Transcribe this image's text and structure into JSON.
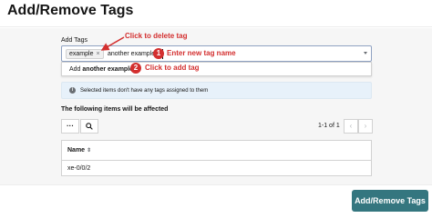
{
  "modal": {
    "title": "Add/Remove Tags",
    "submit_label": "Add/Remove Tags"
  },
  "tags_field": {
    "label": "Add Tags",
    "chips": [
      {
        "label": "example",
        "remove_glyph": "×"
      }
    ],
    "typed_text": "another example",
    "suggestion_prefix": "Add ",
    "suggestion_value": "another example"
  },
  "alert": {
    "icon": "info-icon",
    "icon_glyph": "i",
    "text": "Selected items don't have any tags assigned to them"
  },
  "affected": {
    "label": "The following items will be affected",
    "toolbar": {
      "more_glyph": "···",
      "search_icon": "search-icon"
    },
    "pagination": {
      "text": "1-1 of 1",
      "prev_glyph": "‹",
      "next_glyph": "›"
    },
    "table": {
      "columns": [
        {
          "label": "Name",
          "sort_glyph": "⇕"
        }
      ],
      "rows": [
        [
          "xe-0/0/2"
        ]
      ]
    }
  },
  "annotations": {
    "callout_delete": "Click to delete tag",
    "step1_number": "1",
    "step1_text": "Enter new tag name",
    "step2_number": "2",
    "step2_text": "Click to add tag",
    "color": "#d32f2f"
  },
  "colors": {
    "primary_button": "#34767f",
    "info_background": "#e7f1fa",
    "annotation_red": "#d32f2f",
    "input_focus_border": "#8fa2c2"
  }
}
